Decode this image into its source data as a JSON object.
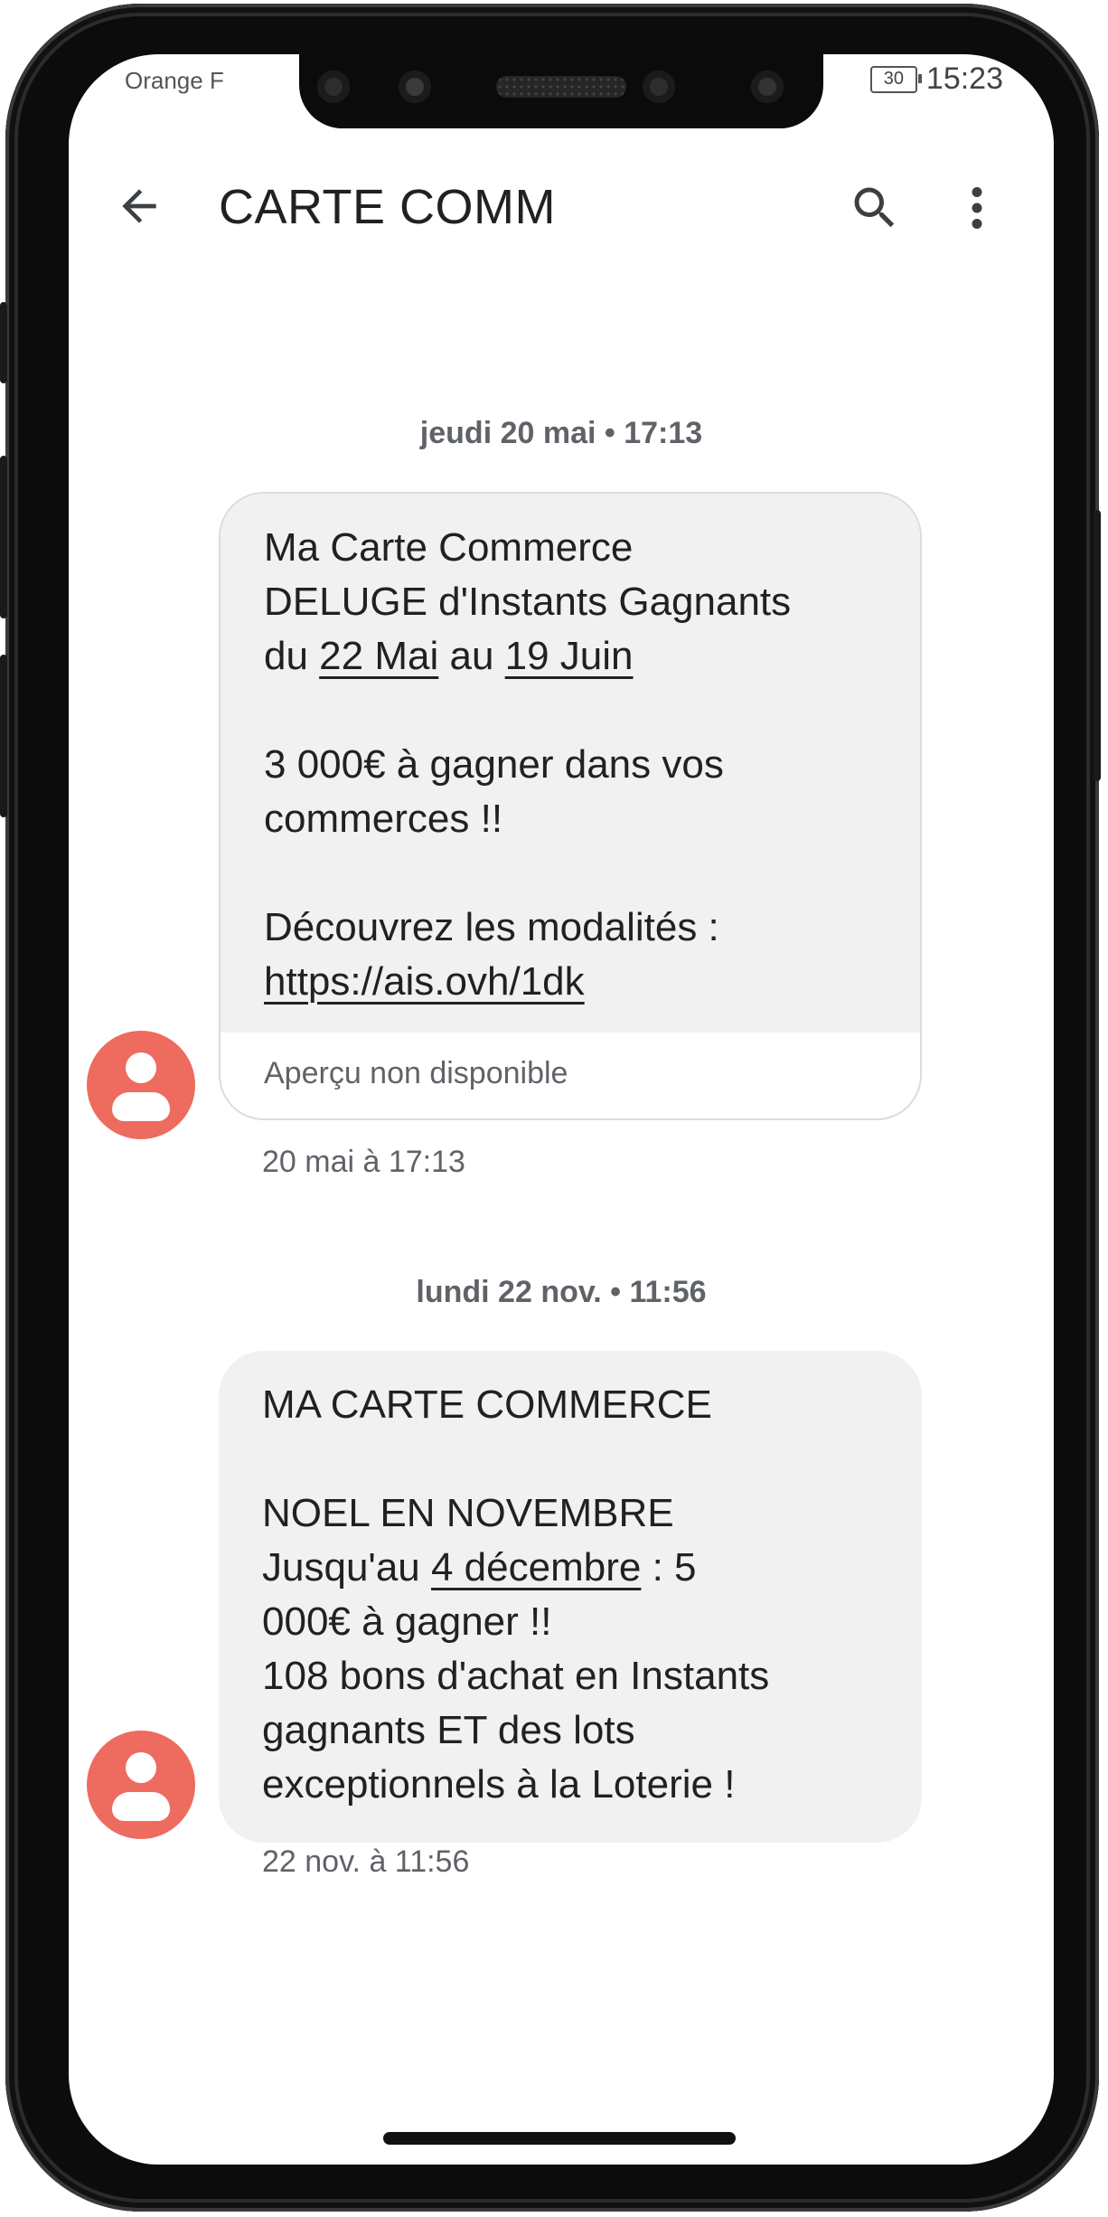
{
  "status_bar": {
    "carrier": "Orange F",
    "battery": "30",
    "time": "15:23"
  },
  "toolbar": {
    "title": "CARTE COMM",
    "back_icon": "arrow-back-icon",
    "search_icon": "search-icon",
    "more_icon": "more-vert-icon"
  },
  "messages": [
    {
      "date_separator": "jeudi 20 mai • 17:13",
      "lines": {
        "l1": "Ma Carte Commerce",
        "l2": "DELUGE d'Instants Gagnants",
        "l3_pre": "du ",
        "l3_date1": "22 Mai",
        "l3_mid": " au ",
        "l3_date2": "19 Juin",
        "l4": "3 000€ à gagner dans vos",
        "l5": "commerces !!",
        "l6": "Découvrez les modalités :",
        "link": "https://ais.ovh/1dk"
      },
      "link_preview": "Aperçu non disponible",
      "timestamp": "20 mai à 17:13"
    },
    {
      "date_separator": "lundi 22 nov. • 11:56",
      "lines": {
        "l1": "MA CARTE COMMERCE",
        "l2": "NOEL EN NOVEMBRE",
        "l3_pre": "Jusqu'au ",
        "l3_date": "4 décembre",
        "l3_post": " : 5",
        "l4": "000€ à gagner !!",
        "l5": "108 bons d'achat en Instants",
        "l6": "gagnants ET des lots",
        "l7": "exceptionnels à la Loterie !"
      },
      "timestamp": "22 nov. à 11:56"
    }
  ],
  "colors": {
    "avatar": "#ee6b60",
    "bubble": "#f1f1f1",
    "text": "#202124",
    "secondary": "#5f6368"
  }
}
